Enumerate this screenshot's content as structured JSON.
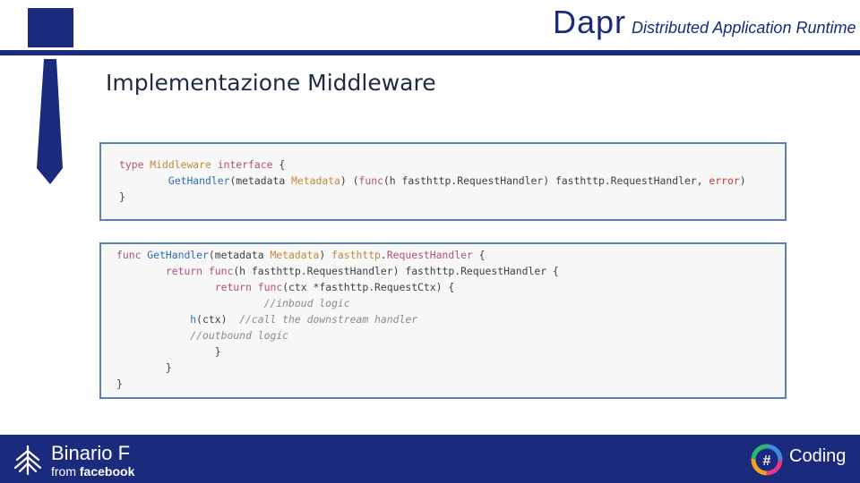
{
  "header": {
    "brand": "Dapr",
    "tagline": "Distributed Application Runtime"
  },
  "slide": {
    "title": "Implementazione Middleware"
  },
  "code_block_1": {
    "lines": [
      "type Middleware interface {",
      "        GetHandler(metadata Metadata) (func(h fasthttp.RequestHandler) fasthttp.RequestHandler, error)",
      "}"
    ]
  },
  "code_block_2": {
    "lines": [
      "func GetHandler(metadata Metadata) fasthttp.RequestHandler {",
      "        return func(h fasthttp.RequestHandler) fasthttp.RequestHandler {",
      "                return func(ctx *fasthttp.RequestCtx) {",
      "                        //inboud logic",
      "            h(ctx)  //call the downstream handler",
      "            //outbound logic",
      "                }",
      "        }",
      "}"
    ]
  },
  "footer": {
    "brand": "Binario F",
    "sub_prefix": "from ",
    "sub_brand": "facebook",
    "coding_label": "Coding",
    "coding_symbol": "#"
  },
  "icons": {
    "left_logo": "binario-f-logo-icon",
    "right_logo": "coding-hash-ring-icon",
    "side_tie": "tie-icon"
  },
  "colors": {
    "primary": "#1a2a7c",
    "code_border": "#5b7fb0",
    "keyword": "#b34f7a",
    "type": "#c3893a",
    "function": "#2f6db5"
  }
}
